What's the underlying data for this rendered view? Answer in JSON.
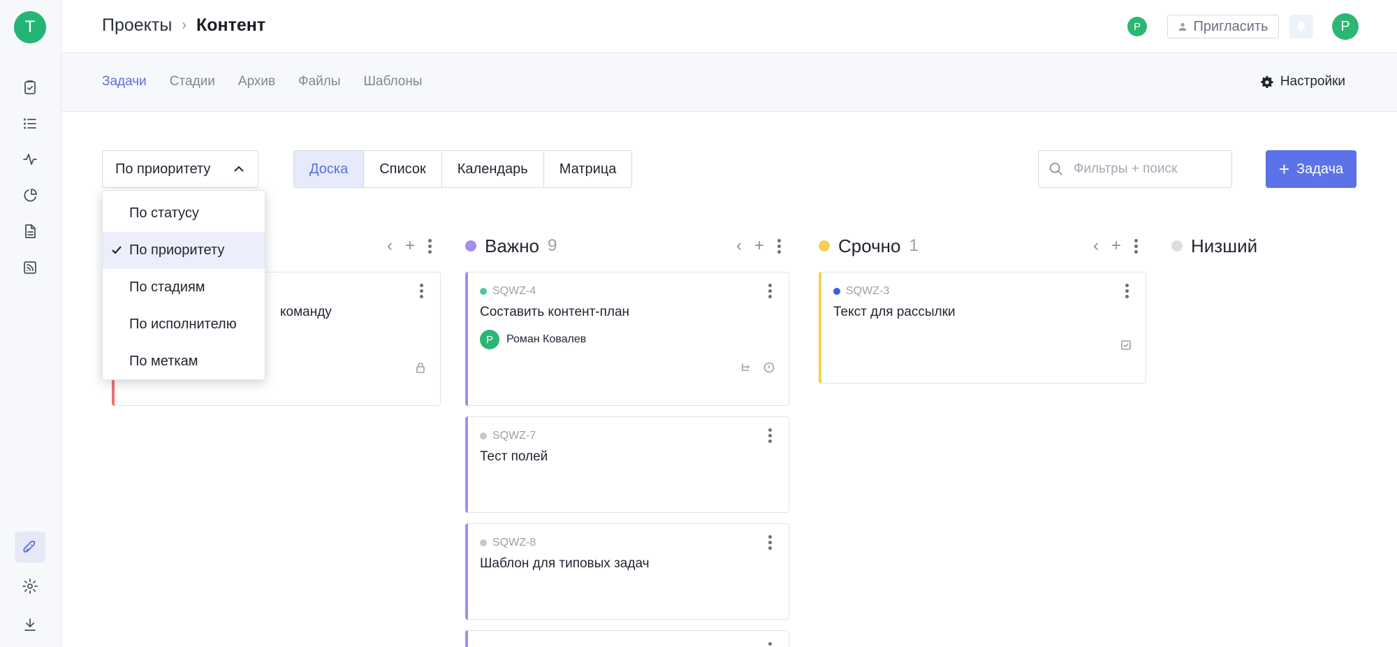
{
  "workspace_initial": "T",
  "breadcrumb": {
    "parent": "Проекты",
    "separator": "›",
    "current": "Контент"
  },
  "header": {
    "member_avatar": "P",
    "invite_label": "Пригласить",
    "user_avatar": "P"
  },
  "tabs": [
    "Задачи",
    "Стадии",
    "Архив",
    "Файлы",
    "Шаблоны"
  ],
  "active_tab": "Задачи",
  "settings_label": "Настройки",
  "grouping": {
    "selected": "По приоритету",
    "options": [
      "По статусу",
      "По приоритету",
      "По стадиям",
      "По исполнителю",
      "По меткам"
    ]
  },
  "views": [
    "Доска",
    "Список",
    "Календарь",
    "Матрица"
  ],
  "active_view": "Доска",
  "search": {
    "placeholder": "Фильтры + поиск"
  },
  "add_task_label": "Задача",
  "columns": [
    {
      "title": "Важно",
      "count": "9",
      "color": "#a48cf0",
      "cards": [
        {
          "id": "SQWZ-4",
          "dot": "#4fc7a6",
          "title": "Составить контент-план",
          "assignee": "Роман Ковалев",
          "assignee_initial": "P"
        },
        {
          "id": "SQWZ-7",
          "dot": "#c5c8cf",
          "title": "Тест полей"
        },
        {
          "id": "SQWZ-8",
          "dot": "#c5c8cf",
          "title": "Шаблон для типовых задач"
        }
      ]
    },
    {
      "title": "Срочно",
      "count": "1",
      "color": "#f7cf52",
      "cards": [
        {
          "id": "SQWZ-3",
          "dot": "#3b5de0",
          "title": "Текст для рассылки"
        }
      ]
    },
    {
      "title": "Низший",
      "count": "",
      "color": "#dcdde0",
      "cards": []
    }
  ],
  "first_column_card_fragment": "команду",
  "colors": {
    "accent": "#5b6ee1",
    "primary_button": "#5b72e8",
    "avatar_green": "#2bb673",
    "urgent_stripe": "#f07070"
  }
}
